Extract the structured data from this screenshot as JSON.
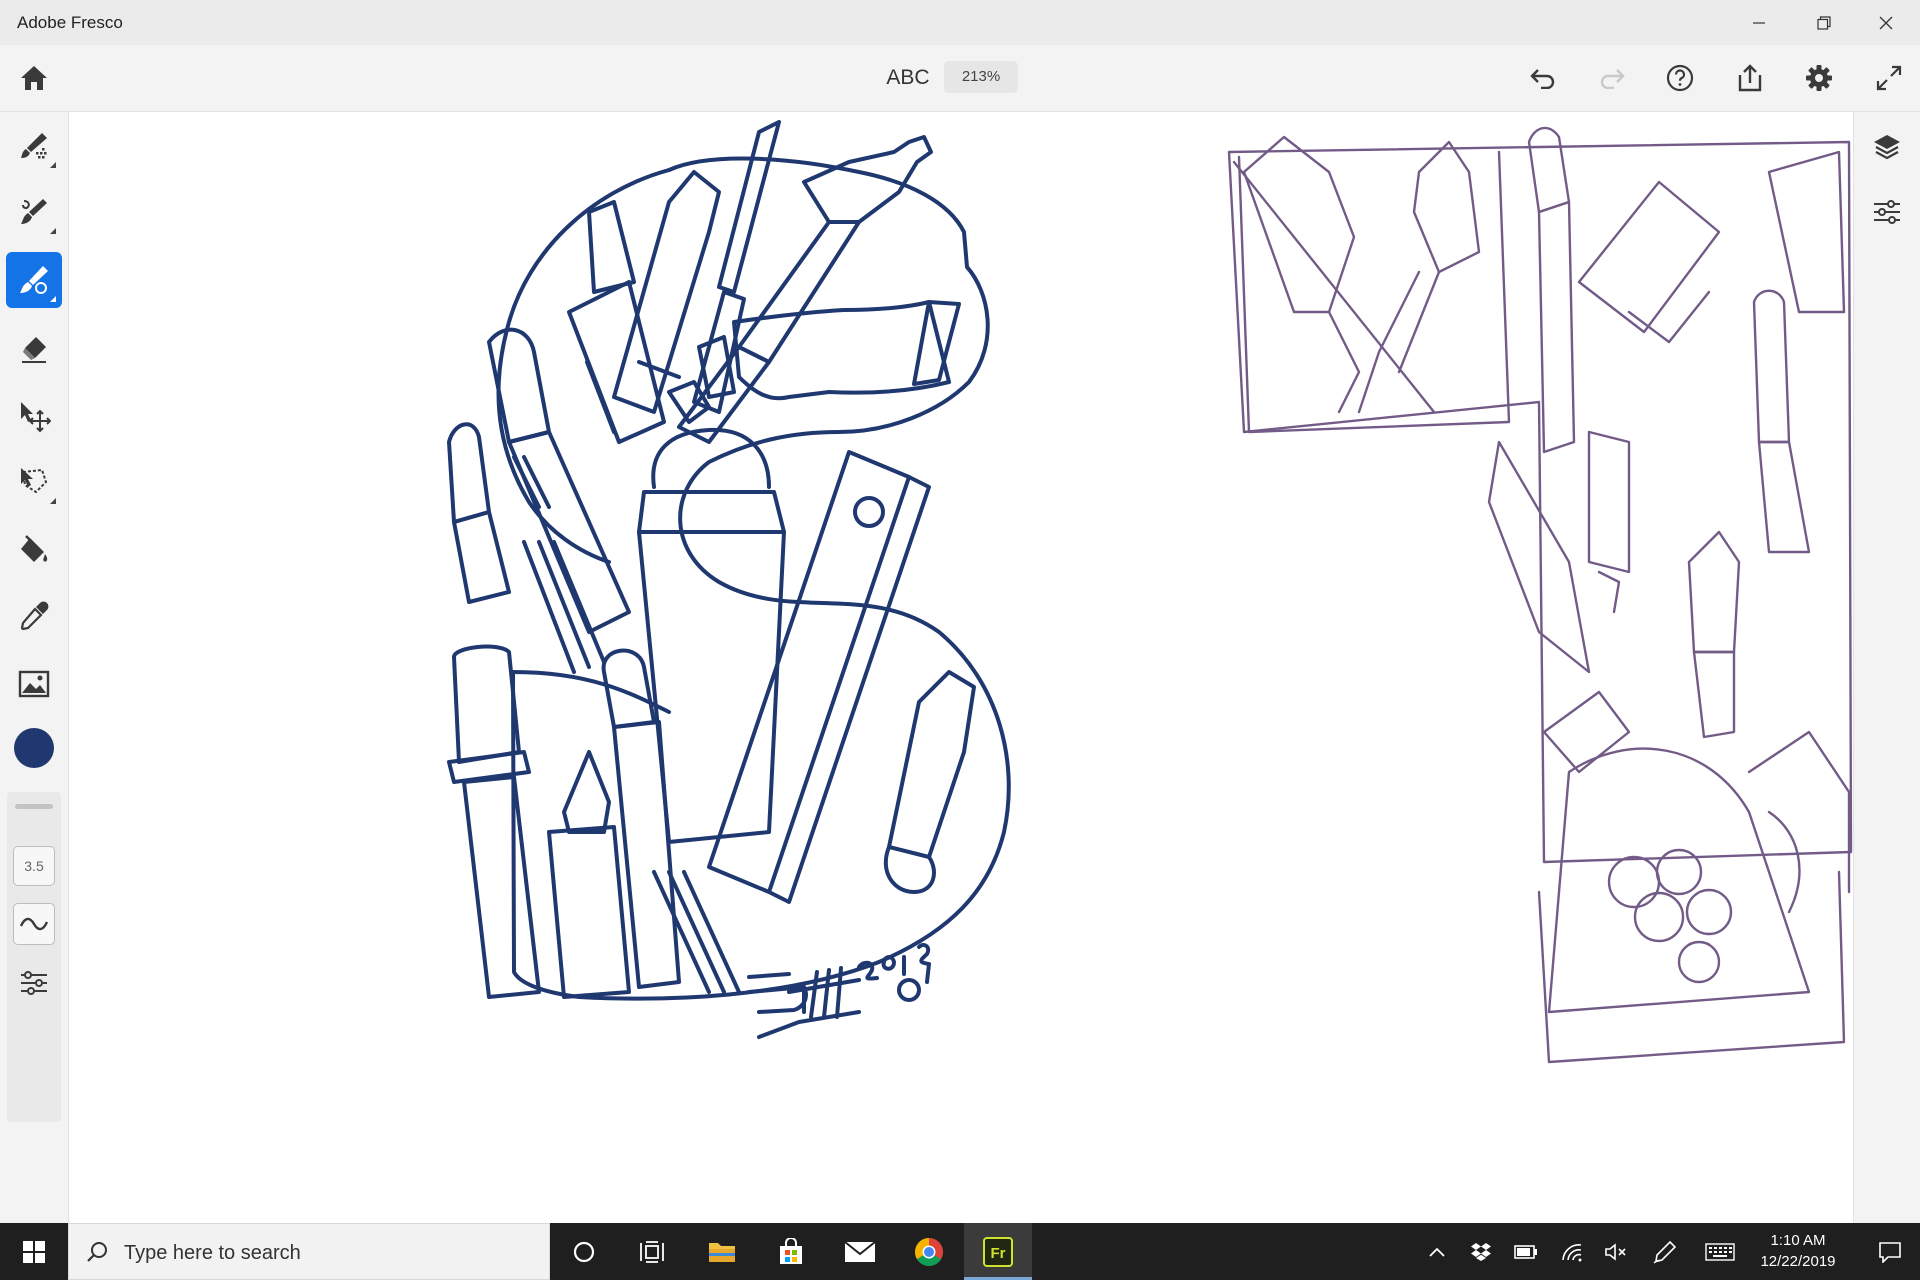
{
  "window": {
    "title": "Adobe Fresco",
    "controls": [
      "minimize-icon",
      "restore-icon",
      "close-icon"
    ]
  },
  "toolbar": {
    "document_title": "ABC",
    "zoom": "213%",
    "buttons": [
      "home-icon",
      "undo-icon",
      "redo-icon",
      "help-icon",
      "share-icon",
      "gear-icon",
      "fullscreen-icon"
    ]
  },
  "left_tools": [
    {
      "name": "pixel-brush-icon"
    },
    {
      "name": "live-brush-icon"
    },
    {
      "name": "vector-brush-icon",
      "active": true
    },
    {
      "name": "eraser-icon"
    },
    {
      "name": "move-transform-icon"
    },
    {
      "name": "lasso-select-icon"
    },
    {
      "name": "fill-bucket-icon"
    },
    {
      "name": "eyedropper-icon"
    },
    {
      "name": "place-image-icon"
    }
  ],
  "brush": {
    "color": "#1f3870",
    "size": "3.5"
  },
  "right_tools": [
    "layers-icon",
    "layer-properties-icon"
  ],
  "colors": {
    "accent": "#1473e6",
    "ink": "#1f3870",
    "sketch": "#5b3f73"
  },
  "taskbar": {
    "search_placeholder": "Type here to search",
    "apps": [
      "cortana-icon",
      "task-view-icon",
      "file-explorer-icon",
      "store-icon",
      "mail-icon",
      "chrome-icon",
      "fresco-icon"
    ],
    "fresco_label": "Fr",
    "tray": [
      "chevron-up-icon",
      "dropbox-icon",
      "battery-icon",
      "wifi-icon",
      "volume-muted-icon",
      "pen-icon",
      "keyboard-icon"
    ],
    "time": "1:10 AM",
    "date": "12/22/2019"
  }
}
